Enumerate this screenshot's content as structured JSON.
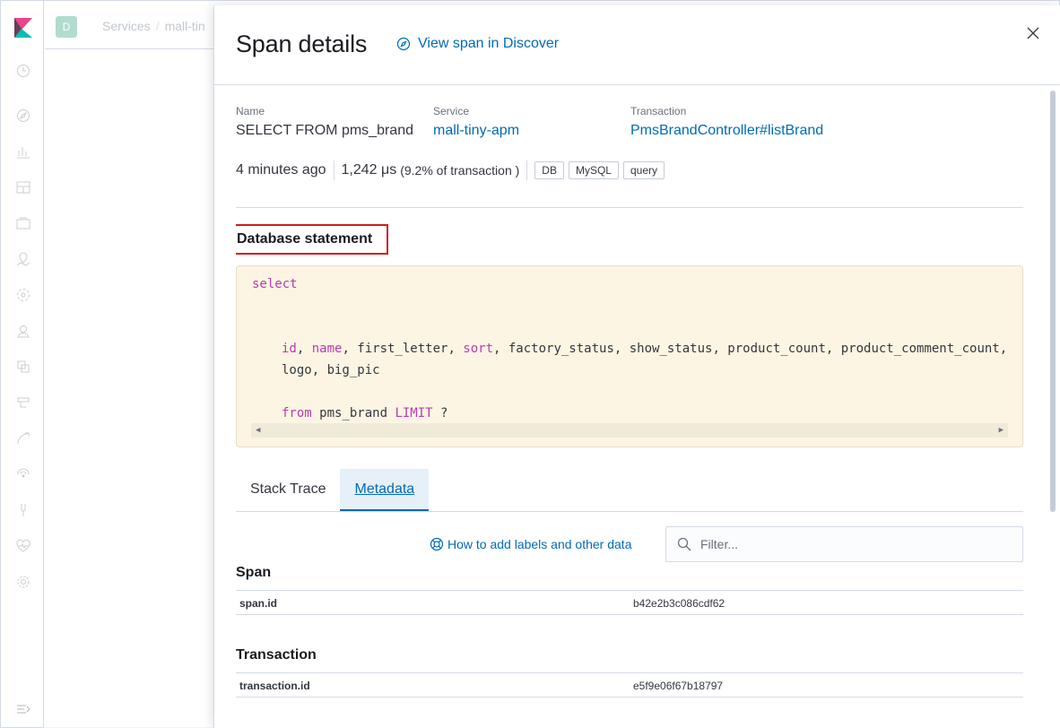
{
  "breadcrumbs": [
    "Services",
    "mall-tin"
  ],
  "space_initial": "D",
  "flyout": {
    "title": "Span details",
    "discover_link": "View span in Discover"
  },
  "summary": {
    "name_label": "Name",
    "name_value": "SELECT FROM pms_brand",
    "service_label": "Service",
    "service_value": "mall-tiny-apm",
    "transaction_label": "Transaction",
    "transaction_value": "PmsBrandController#listBrand"
  },
  "meta": {
    "time_ago": "4 minutes ago",
    "duration": "1,242 μs",
    "percent": "(9.2% of transaction )",
    "badges": [
      "DB",
      "MySQL",
      "query"
    ]
  },
  "db_statement_title": "Database statement",
  "code": {
    "line1_kw": "select",
    "line2": {
      "id": "id",
      "sep1": ", ",
      "name": "name",
      "mid": ", first_letter, ",
      "sort": "sort",
      "rest": ", factory_status, show_status, product_count, product_comment_count,"
    },
    "line3": "logo, big_pic",
    "line4": {
      "from": "from",
      "table": " pms_brand ",
      "limit": "LIMIT",
      "param": " ?"
    }
  },
  "tabs": [
    "Stack Trace",
    "Metadata"
  ],
  "help_link": "How to add labels and other data",
  "filter_placeholder": "Filter...",
  "sections": [
    {
      "title": "Span",
      "key": "span.id",
      "value": "b42e2b3c086cdf62"
    },
    {
      "title": "Transaction",
      "key": "transaction.id",
      "value": "e5f9e06f67b18797"
    }
  ],
  "colors": {
    "link": "#006bb4",
    "keyword": "#b83bb0",
    "highlight_box": "#d31b1b",
    "code_bg": "#fdf5e3"
  }
}
